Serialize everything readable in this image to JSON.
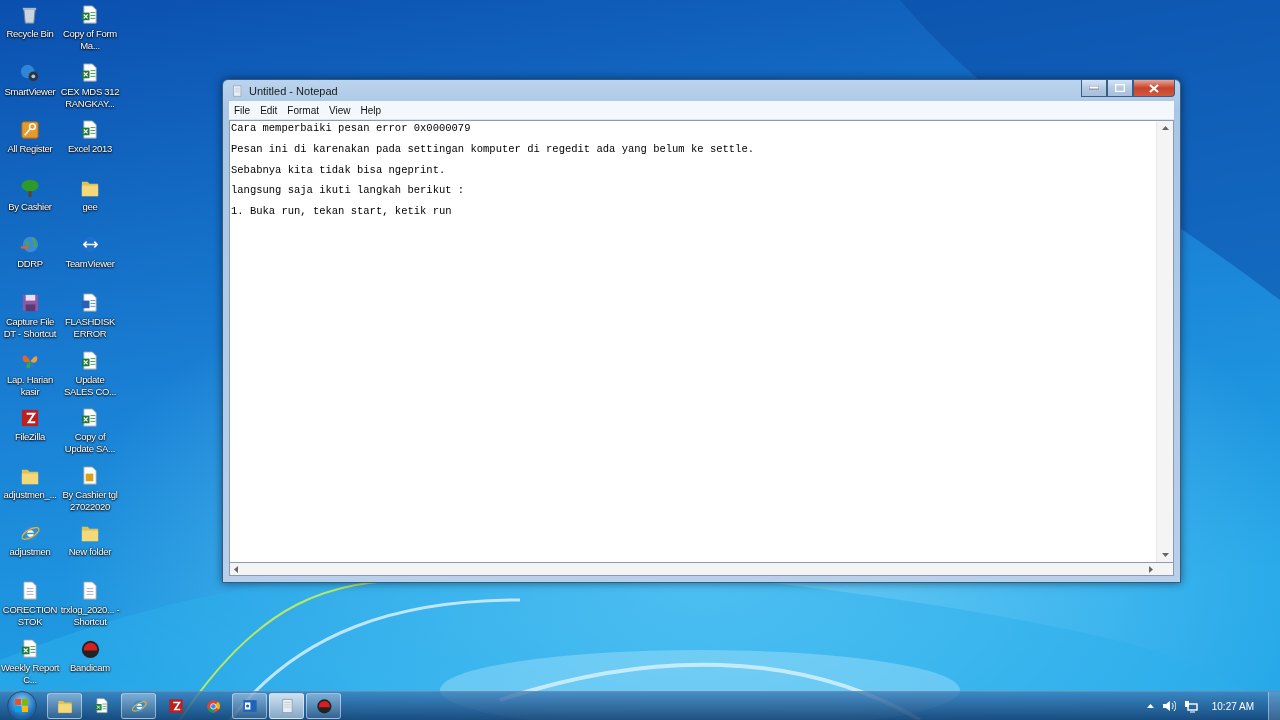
{
  "desktop_icons": [
    {
      "label": "Recycle Bin",
      "kind": "recycle"
    },
    {
      "label": "SmartViewer",
      "kind": "viewer"
    },
    {
      "label": "All Register",
      "kind": "key"
    },
    {
      "label": "By Cashier",
      "kind": "tree"
    },
    {
      "label": "DDRP",
      "kind": "globe"
    },
    {
      "label": "Capture File DT - Shortcut",
      "kind": "floppy"
    },
    {
      "label": "Lap. Harian kasir",
      "kind": "butterfly"
    },
    {
      "label": "FileZilla",
      "kind": "filezilla"
    },
    {
      "label": "adjustmen_...",
      "kind": "folder"
    },
    {
      "label": "adjustmen",
      "kind": "ie"
    },
    {
      "label": "CORECTION STOK",
      "kind": "doc"
    },
    {
      "label": "Weekly Report C...",
      "kind": "excel"
    },
    {
      "label": "Copy of Form  Ma...",
      "kind": "excel"
    },
    {
      "label": "CEX MDS 312 RANGKAY...",
      "kind": "excel"
    },
    {
      "label": "Excel 2013",
      "kind": "excel"
    },
    {
      "label": "gee",
      "kind": "folder"
    },
    {
      "label": "TeamViewer",
      "kind": "teamviewer"
    },
    {
      "label": "FLASHDISK ERROR",
      "kind": "word"
    },
    {
      "label": "Update SALES CO...",
      "kind": "excel"
    },
    {
      "label": "Copy of Update SA...",
      "kind": "excel"
    },
    {
      "label": "By  Cashier tgl 27022020",
      "kind": "archive"
    },
    {
      "label": "New folder",
      "kind": "folder"
    },
    {
      "label": "trxlog_2020... - Shortcut",
      "kind": "doc"
    },
    {
      "label": "Bandicam",
      "kind": "bandicam"
    }
  ],
  "notepad": {
    "title": "Untitled - Notepad",
    "menu": [
      "File",
      "Edit",
      "Format",
      "View",
      "Help"
    ],
    "lines": [
      "Cara memperbaiki pesan error 0x0000079",
      "Pesan ini di karenakan pada settingan komputer di regedit ada yang belum ke settle.",
      "Sebabnya kita tidak bisa ngeprint.",
      "langsung saja ikuti langkah berikut :",
      "1. Buka run, tekan start, ketik run"
    ]
  },
  "taskbar": {
    "items": [
      {
        "kind": "folder",
        "running": true,
        "active": false
      },
      {
        "kind": "excel",
        "running": false,
        "active": false
      },
      {
        "kind": "ie",
        "running": true,
        "active": false
      },
      {
        "kind": "filezilla",
        "running": false,
        "active": false
      },
      {
        "kind": "chrome",
        "running": false,
        "active": false
      },
      {
        "kind": "outlook",
        "running": true,
        "active": false
      },
      {
        "kind": "notepad",
        "running": true,
        "active": true
      },
      {
        "kind": "bandicam",
        "running": true,
        "active": false
      }
    ],
    "clock": "10:27 AM"
  }
}
